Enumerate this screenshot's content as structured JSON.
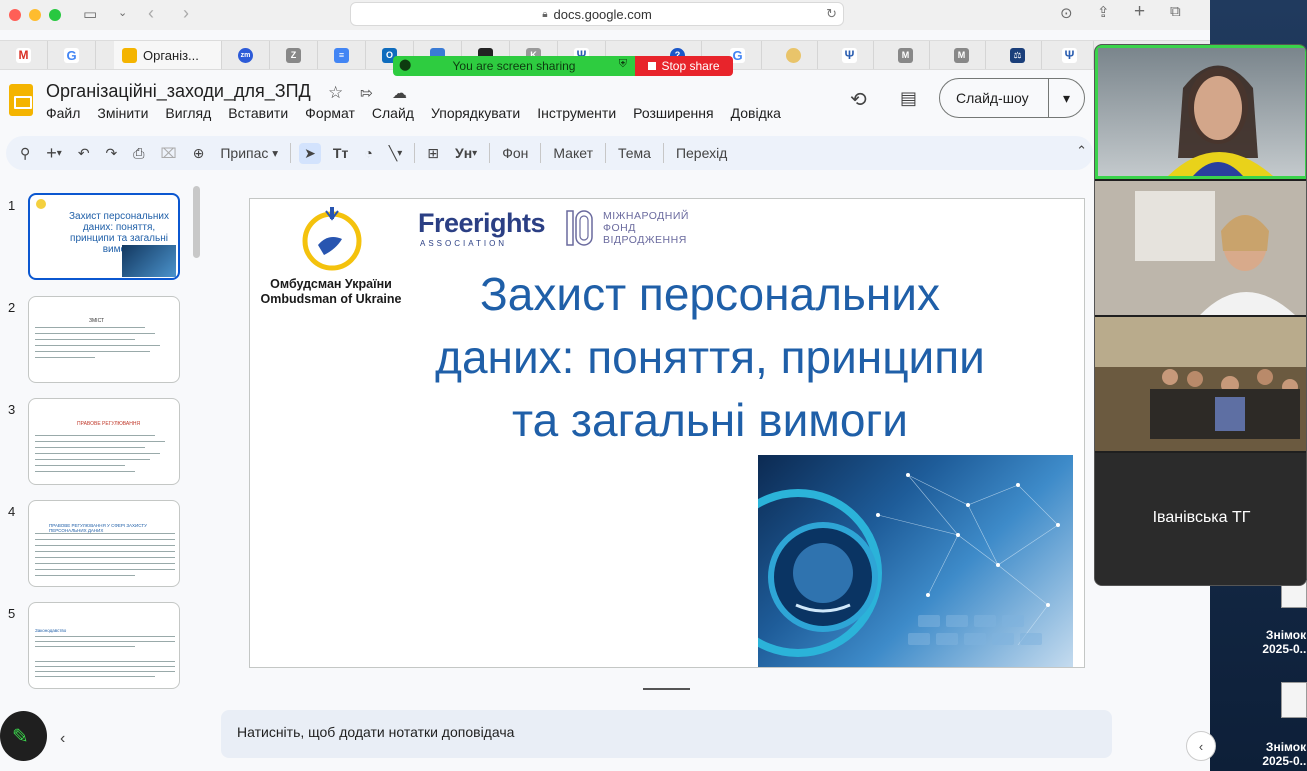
{
  "browser": {
    "url": "docs.google.com",
    "active_tab_title": "Організ...",
    "tab_icons": [
      "gmail-icon",
      "google-icon",
      "slides-icon",
      "zoom-icon",
      "zendesk-icon",
      "docs-icon",
      "outlook-icon",
      "tab-icon",
      "tab-icon",
      "tab-icon",
      "ukraine-trident-icon",
      "tab-icon",
      "google-icon",
      "tab-icon",
      "ukraine-trident-icon",
      "m-icon",
      "m-icon",
      "scales-icon",
      "ukraine-trident-icon"
    ]
  },
  "screen_share": {
    "status_text": "You are screen sharing",
    "stop_label": "Stop share"
  },
  "slides_app": {
    "doc_title": "Організаційні_заходи_для_ЗПД",
    "menu": [
      "Файл",
      "Змінити",
      "Вигляд",
      "Вставити",
      "Формат",
      "Слайд",
      "Упорядкувати",
      "Інструменти",
      "Розширення",
      "Довідка"
    ],
    "slideshow_label": "Слайд-шоу",
    "toolbar": {
      "zoom_label": "Припас",
      "background_label": "Фон",
      "layout_label": "Макет",
      "theme_label": "Тема",
      "transition_label": "Перехід"
    },
    "thumbnails": [
      {
        "number": "1",
        "title": "Захист персональних даних: поняття, принципи та загальні вимоги"
      },
      {
        "number": "2",
        "title": "ЗМІСТ"
      },
      {
        "number": "3",
        "title": "ПРАВОВЕ РЕГУЛЮВАННЯ"
      },
      {
        "number": "4",
        "title": "ПРАВОВЕ РЕГУЛЮВАННЯ У СФЕРІ ЗАХИСТУ ПЕРСОНАЛЬНИХ ДАНИХ"
      },
      {
        "number": "5",
        "title": "Законодавство"
      }
    ],
    "slide": {
      "ombudsman_ua": "Омбудсман України",
      "ombudsman_en": "Ombudsman of Ukraine",
      "freerights": "Freerights",
      "freerights_sub": "ASSOCIATION",
      "irf_line1": "МІЖНАРОДНИЙ",
      "irf_line2": "ФОНД",
      "irf_line3": "ВІДРОДЖЕННЯ",
      "title_line1": "Захист персональних",
      "title_line2": "даних: поняття, принципи",
      "title_line3": "та загальні вимоги"
    },
    "notes_placeholder": "Натисніть, щоб додати нотатки доповідача"
  },
  "video_call": {
    "participant_name": "Іванівська ТГ"
  },
  "desktop": {
    "items": [
      {
        "line1": "Знімок",
        "line2": "2025-0..."
      },
      {
        "line1": "Знімок",
        "line2": "2025-0..."
      }
    ]
  },
  "colors": {
    "slide_title": "#1f5fa8",
    "accent_blue": "#0b57d0",
    "share_green": "#2ecc40",
    "share_red": "#e8242b"
  }
}
